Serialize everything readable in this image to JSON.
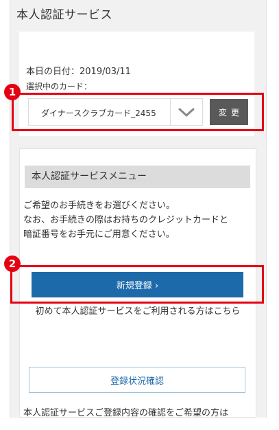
{
  "page": {
    "title": "本人認証サービス"
  },
  "card_section": {
    "date_line": "本日の日付：2019/03/11",
    "card_label": "選択中のカード：",
    "selected_card": "ダイナースクラブカード_2455",
    "change_button": "変更"
  },
  "markers": {
    "marker_1": "1",
    "marker_2": "2"
  },
  "menu": {
    "header": "本人認証サービスメニュー",
    "instructions": [
      "ご希望のお手続きをお選びください。",
      "なお、お手続きの際はお持ちのクレジットカードと",
      "暗証番号をお手元にご用意ください。"
    ],
    "register_button": "新規登録 ›",
    "first_time_note": "初めて本人認証サービスをご利用される方はこちら",
    "status_button": "登録状況確認",
    "bottom_note": "本人認証サービスご登録内容の確認をご希望の方は"
  },
  "colors": {
    "highlight_red": "#e60012",
    "primary_blue": "#1d6aaa",
    "change_button_gray": "#595959"
  },
  "icons": {
    "dropdown": "chevron-down-icon"
  }
}
